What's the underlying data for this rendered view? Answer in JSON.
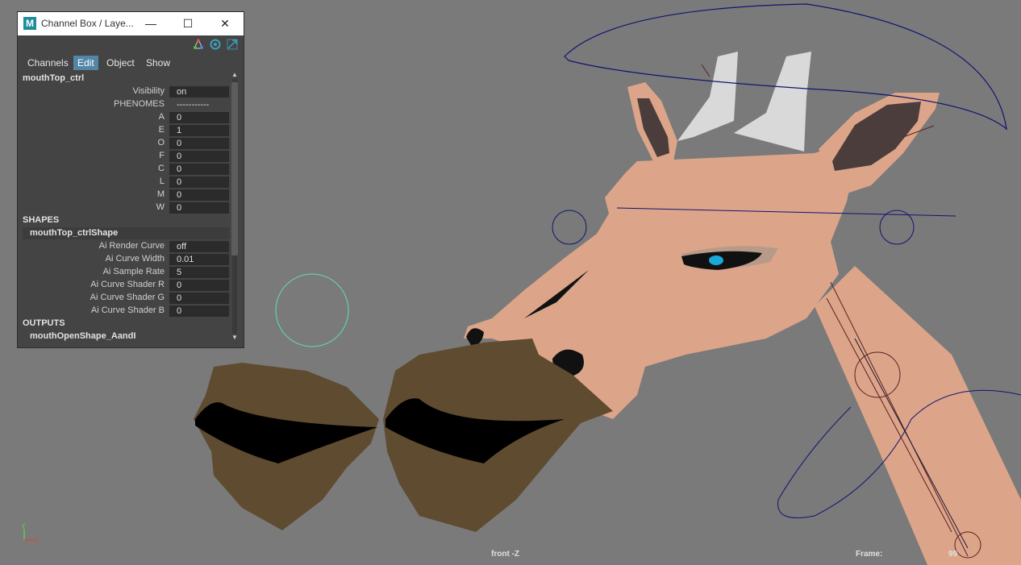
{
  "window": {
    "title": "Channel Box / Laye...",
    "logo": "M",
    "controls": {
      "minimize": "—",
      "maximize": "☐",
      "close": "✕"
    },
    "tool_icons": [
      "selection-set-icon",
      "sync-icon",
      "expand-icon"
    ]
  },
  "menu": {
    "channels": "Channels",
    "edit": "Edit",
    "object": "Object",
    "show": "Show"
  },
  "node": {
    "name": "mouthTop_ctrl",
    "attributes": [
      {
        "label": "Visibility",
        "value": "on"
      },
      {
        "label": "PHENOMES",
        "value": "-----------"
      },
      {
        "label": "A",
        "value": "0"
      },
      {
        "label": "E",
        "value": "1"
      },
      {
        "label": "O",
        "value": "0"
      },
      {
        "label": "F",
        "value": "0"
      },
      {
        "label": "C",
        "value": "0"
      },
      {
        "label": "L",
        "value": "0"
      },
      {
        "label": "M",
        "value": "0"
      },
      {
        "label": "W",
        "value": "0"
      }
    ]
  },
  "shapes": {
    "header": "SHAPES",
    "name": "mouthTop_ctrlShape",
    "attributes": [
      {
        "label": "Ai Render Curve",
        "value": "off"
      },
      {
        "label": "Ai Curve Width",
        "value": "0.01"
      },
      {
        "label": "Ai Sample Rate",
        "value": "5"
      },
      {
        "label": "Ai Curve Shader R",
        "value": "0"
      },
      {
        "label": "Ai Curve Shader G",
        "value": "0"
      },
      {
        "label": "Ai Curve Shader B",
        "value": "0"
      }
    ]
  },
  "outputs": {
    "header": "OUTPUTS",
    "name": "mouthOpenShape_AandI"
  },
  "viewport": {
    "camera": "front -Z",
    "frame_label": "Frame:",
    "frame_value": "99",
    "axis_labels": {
      "y": "y",
      "x": "x"
    }
  },
  "colors": {
    "viewport_bg": "#7a7a7a",
    "skin": "#dca58a",
    "mouth": "#5f4b30",
    "curve": "#101470",
    "active_curve": "#5fe0b4",
    "eye": "#1aa8d8"
  }
}
